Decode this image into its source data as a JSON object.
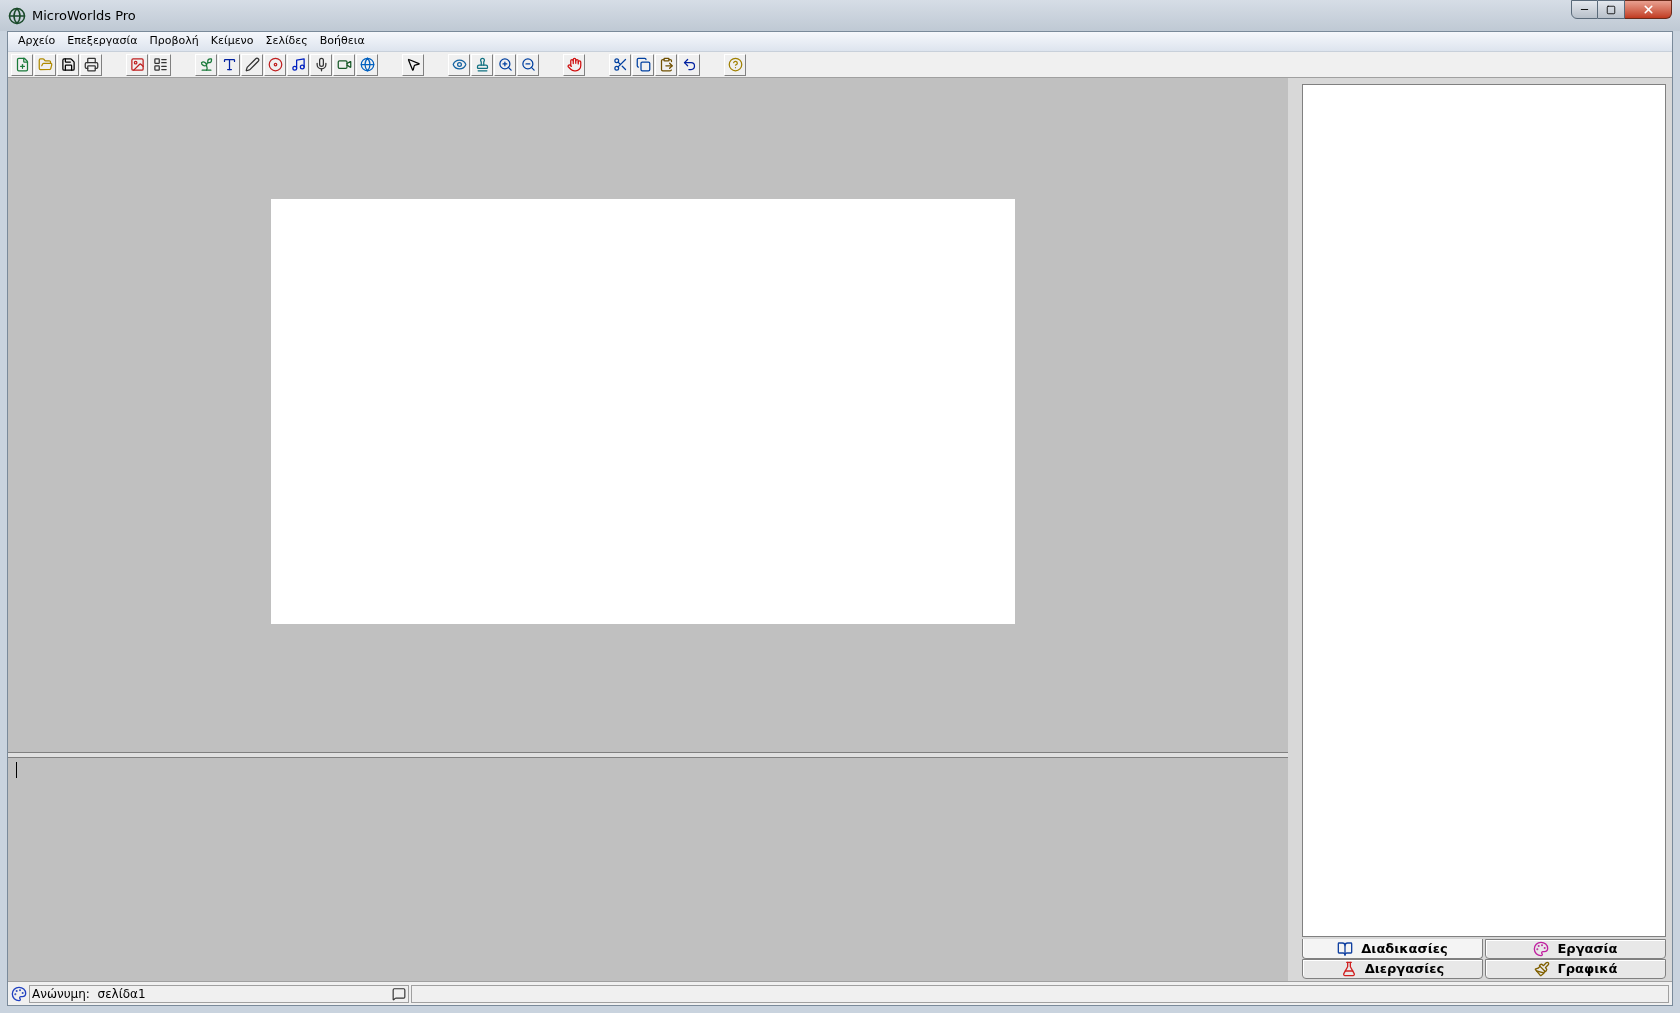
{
  "window": {
    "title": "MicroWorlds Pro"
  },
  "menu": [
    "Αρχείο",
    "Επεξεργασία",
    "Προβολή",
    "Κείμενο",
    "Σελίδες",
    "Βοήθεια"
  ],
  "tabs": [
    {
      "label": "Διαδικασίες",
      "selected": true,
      "kind": "procedures"
    },
    {
      "label": "Εργασία",
      "selected": false,
      "kind": "project"
    },
    {
      "label": "Διεργασίες",
      "selected": false,
      "kind": "processes"
    },
    {
      "label": "Γραφικά",
      "selected": false,
      "kind": "graphics"
    }
  ],
  "status_bar": {
    "text": "Ανώνυμη:  σελίδα1"
  }
}
